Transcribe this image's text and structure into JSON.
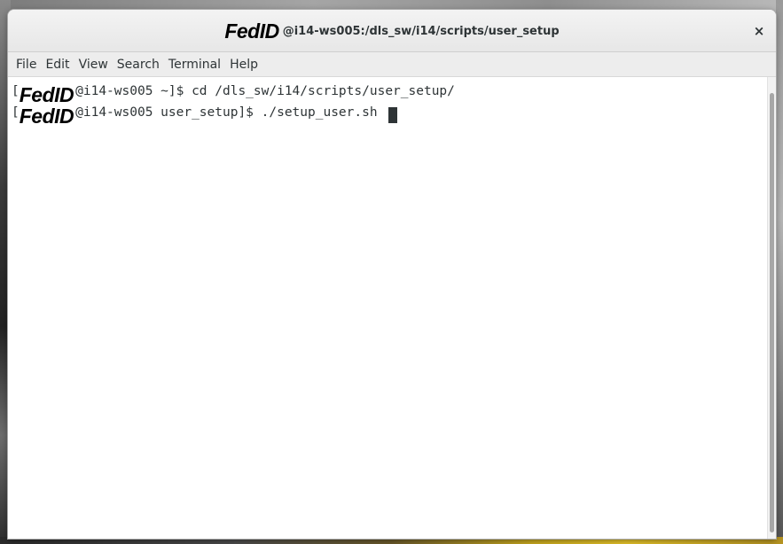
{
  "window": {
    "title_fedid": "FedID",
    "title_path": "@i14-ws005:/dls_sw/i14/scripts/user_setup",
    "close_glyph": "×"
  },
  "menu": {
    "items": [
      "File",
      "Edit",
      "View",
      "Search",
      "Terminal",
      "Help"
    ]
  },
  "terminal": {
    "lines": [
      {
        "bracket": "[",
        "fedid": "FedID",
        "text": "@i14-ws005 ~]$ cd /dls_sw/i14/scripts/user_setup/"
      },
      {
        "bracket": "[",
        "fedid": "FedID",
        "text": "@i14-ws005 user_setup]$ ./setup_user.sh "
      }
    ]
  },
  "colors": {
    "terminal_bg": "#ffffff",
    "terminal_fg": "#2e3436",
    "titlebar_bg": "#ececec"
  },
  "icons": {
    "close": "close-icon"
  }
}
